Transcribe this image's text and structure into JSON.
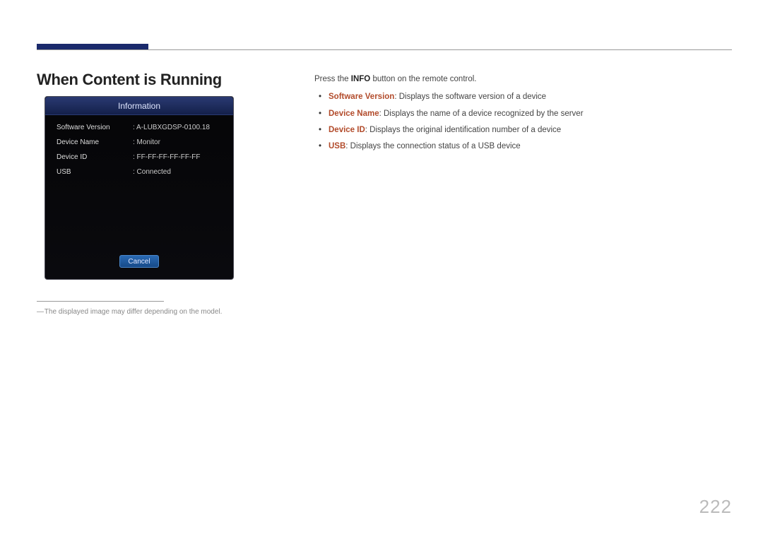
{
  "heading": "When Content is Running",
  "panel": {
    "title": "Information",
    "rows": [
      {
        "label": "Software Version",
        "value": ": A-LUBXGDSP-0100.18"
      },
      {
        "label": "Device Name",
        "value": ": Monitor"
      },
      {
        "label": "Device ID",
        "value": ": FF-FF-FF-FF-FF-FF"
      },
      {
        "label": "USB",
        "value": ": Connected"
      }
    ],
    "cancel": "Cancel"
  },
  "disclaimer": "The displayed image may differ depending on the model.",
  "right": {
    "intro_pre": "Press the ",
    "intro_bold": "INFO",
    "intro_post": " button on the remote control.",
    "bullets": [
      {
        "key": "Software Version",
        "desc": ": Displays the software version of a device"
      },
      {
        "key": "Device Name",
        "desc": ": Displays the name of a device recognized by the server"
      },
      {
        "key": "Device ID",
        "desc": ": Displays the original identification number of a device"
      },
      {
        "key": "USB",
        "desc": ": Displays the connection status of a USB device"
      }
    ]
  },
  "page_number": "222"
}
